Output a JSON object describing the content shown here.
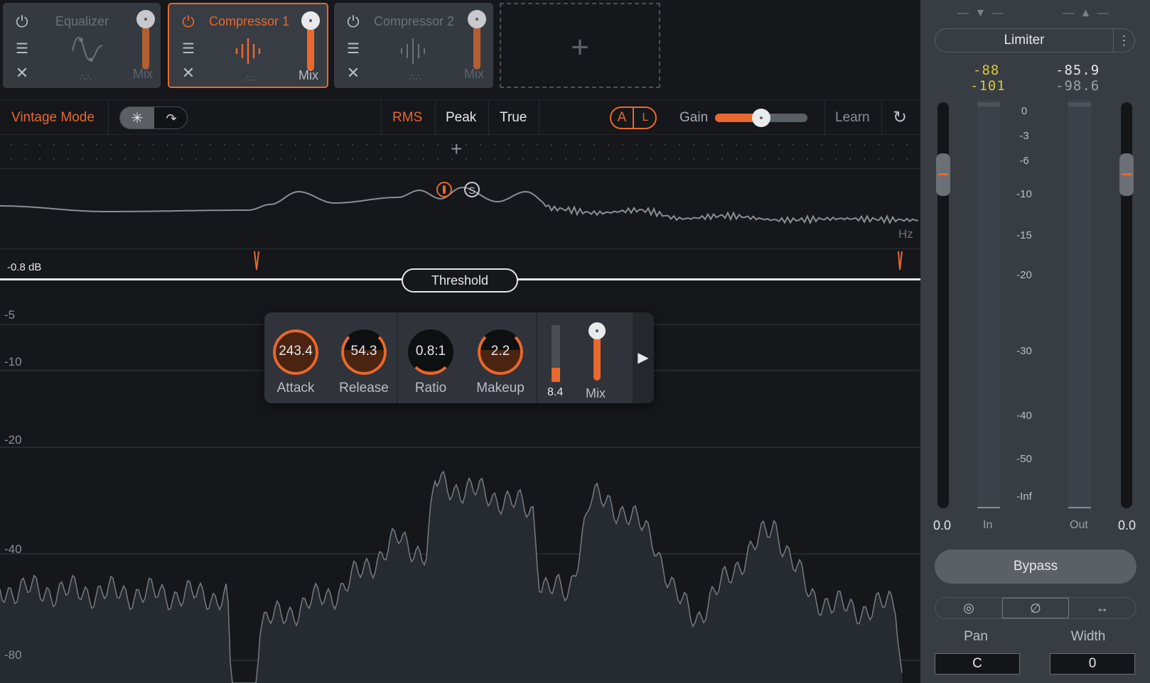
{
  "modules": [
    {
      "title": "Equalizer",
      "mix_label": "Mix",
      "active": false,
      "mix_percent": 100
    },
    {
      "title": "Compressor 1",
      "mix_label": "Mix",
      "active": true,
      "mix_percent": 100
    },
    {
      "title": "Compressor 2",
      "mix_label": "Mix",
      "active": false,
      "mix_percent": 100
    }
  ],
  "add_module_icon": "+",
  "toolbar": {
    "vintage_mode": "Vintage Mode",
    "modes": [
      "RMS",
      "Peak",
      "True"
    ],
    "selected_mode": "RMS",
    "ab_a": "A",
    "ab_b": "L",
    "gain_label": "Gain",
    "gain_percent": 50,
    "learn_label": "Learn"
  },
  "band_row": {
    "add_icon": "+"
  },
  "detector": {
    "hz_label": "Hz",
    "db_readout": "-0.8 dB",
    "solo_icon_label": "S"
  },
  "threshold": {
    "label": "Threshold"
  },
  "axis_labels": [
    "-5",
    "-10",
    "-20",
    "-40",
    "-80"
  ],
  "compressor": {
    "attack": {
      "value": "243.4",
      "label": "Attack",
      "fill": 1.0
    },
    "release": {
      "value": "54.3",
      "label": "Release",
      "fill": 0.55
    },
    "ratio": {
      "value": "0.8:1",
      "label": "Ratio",
      "fill": 0.1
    },
    "makeup": {
      "value": "2.2",
      "label": "Makeup",
      "fill": 0.55
    },
    "gain_reduction": {
      "value": "8.4",
      "fill": 0.25
    },
    "mix": {
      "label": "Mix",
      "percent": 100
    }
  },
  "side": {
    "limiter_label": "Limiter",
    "menu_icon": "⋮",
    "in_peak": "-88",
    "in_rms": "-101",
    "out_peak": "-85.9",
    "out_rms": "-98.6",
    "scale": [
      "0",
      "-3",
      "-6",
      "-10",
      "-15",
      "-20",
      "-30",
      "-40",
      "-50",
      "-Inf"
    ],
    "in_gain": "0.0",
    "out_gain": "0.0",
    "in_label": "In",
    "out_label": "Out",
    "bypass_label": "Bypass",
    "pan_label": "Pan",
    "width_label": "Width",
    "pan_value": "C",
    "width_value": "0",
    "colors": {
      "peak_in": "#d6c83a",
      "peak_out": "#e6e7e9",
      "rms_out": "#9aa0a7",
      "accent": "#e9682d"
    }
  }
}
